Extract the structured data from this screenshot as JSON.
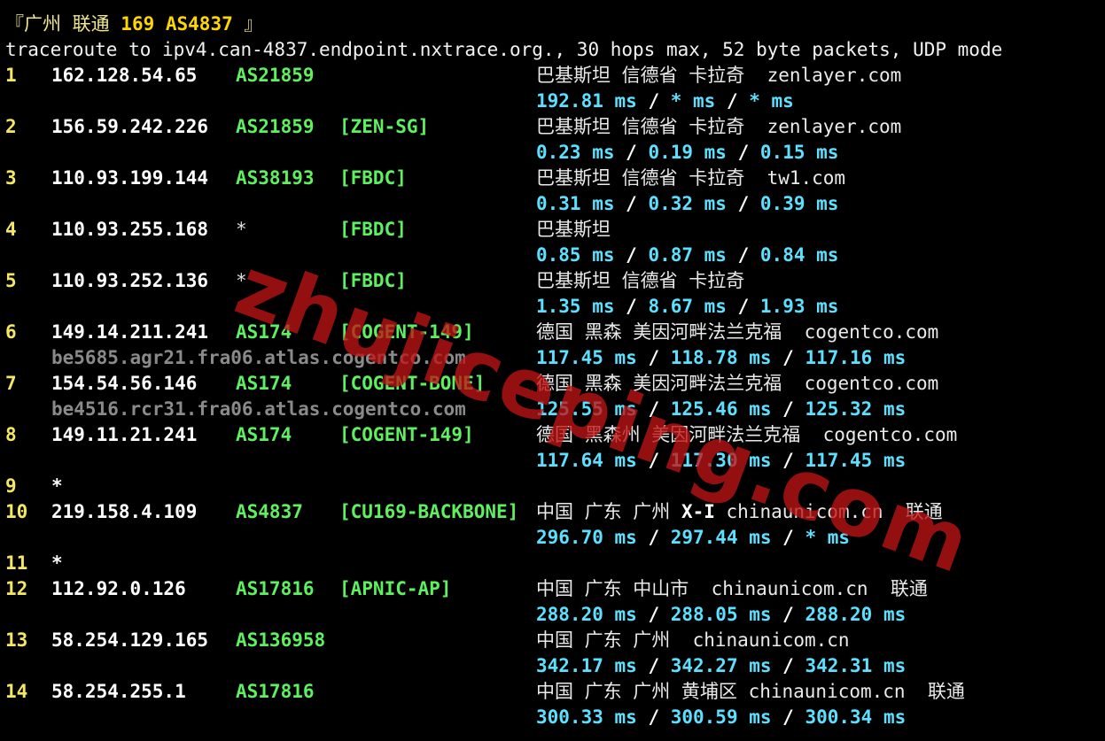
{
  "header": {
    "title_open": "『广州 联通 ",
    "title_bold": "169 AS4837",
    "title_close": " 』",
    "command": "traceroute to ipv4.can-4837.endpoint.nxtrace.org., 30 hops max, 52 byte packets, UDP mode"
  },
  "hops": [
    {
      "num": "1",
      "ip": "162.128.54.65",
      "as": "AS21859",
      "tag": "",
      "geo": "巴基斯坦 信德省 卡拉奇  zenlayer.com",
      "geo_hl": "",
      "rtt": [
        "192.81 ms",
        "* ms",
        "* ms"
      ],
      "rdns": ""
    },
    {
      "num": "2",
      "ip": "156.59.242.226",
      "as": "AS21859",
      "tag": "[ZEN-SG]",
      "geo": "巴基斯坦 信德省 卡拉奇  zenlayer.com",
      "geo_hl": "",
      "rtt": [
        "0.23 ms",
        "0.19 ms",
        "0.15 ms"
      ],
      "rdns": ""
    },
    {
      "num": "3",
      "ip": "110.93.199.144",
      "as": "AS38193",
      "tag": "[FBDC]",
      "geo": "巴基斯坦 信德省 卡拉奇  tw1.com",
      "geo_hl": "",
      "rtt": [
        "0.31 ms",
        "0.32 ms",
        "0.39 ms"
      ],
      "rdns": ""
    },
    {
      "num": "4",
      "ip": "110.93.255.168",
      "as": "*",
      "tag": "[FBDC]",
      "geo": "巴基斯坦",
      "geo_hl": "",
      "rtt": [
        "0.85 ms",
        "0.87 ms",
        "0.84 ms"
      ],
      "rdns": ""
    },
    {
      "num": "5",
      "ip": "110.93.252.136",
      "as": "*",
      "tag": "[FBDC]",
      "geo": "巴基斯坦 信德省 卡拉奇",
      "geo_hl": "",
      "rtt": [
        "1.35 ms",
        "8.67 ms",
        "1.93 ms"
      ],
      "rdns": ""
    },
    {
      "num": "6",
      "ip": "149.14.211.241",
      "as": "AS174",
      "tag": "[COGENT-149]",
      "geo": "德国 黑森 美因河畔法兰克福  cogentco.com",
      "geo_hl": "",
      "rtt": [
        "117.45 ms",
        "118.78 ms",
        "117.16 ms"
      ],
      "rdns": "be5685.agr21.fra06.atlas.cogentco.com"
    },
    {
      "num": "7",
      "ip": "154.54.56.146",
      "as": "AS174",
      "tag": "[COGENT-BONE]",
      "geo": "德国 黑森 美因河畔法兰克福  cogentco.com",
      "geo_hl": "",
      "rtt": [
        "125.55 ms",
        "125.46 ms",
        "125.32 ms"
      ],
      "rdns": "be4516.rcr31.fra06.atlas.cogentco.com"
    },
    {
      "num": "8",
      "ip": "149.11.21.241",
      "as": "AS174",
      "tag": "[COGENT-149]",
      "geo": "德国 黑森州 美因河畔法兰克福  cogentco.com",
      "geo_hl": "",
      "rtt": [
        "117.64 ms",
        "117.30 ms",
        "117.45 ms"
      ],
      "rdns": ""
    },
    {
      "num": "9",
      "ip": "*",
      "as": "",
      "tag": "",
      "geo": "",
      "geo_hl": "",
      "rtt": [],
      "rdns": ""
    },
    {
      "num": "10",
      "ip": "219.158.4.109",
      "as": "AS4837",
      "tag": "[CU169-BACKBONE]",
      "geo": "中国 广东 广州 ",
      "geo_hl": "X-I",
      "geo_tail": " chinaunicom.cn  联通",
      "rtt": [
        "296.70 ms",
        "297.44 ms",
        "* ms"
      ],
      "rdns": ""
    },
    {
      "num": "11",
      "ip": "*",
      "as": "",
      "tag": "",
      "geo": "",
      "geo_hl": "",
      "rtt": [],
      "rdns": ""
    },
    {
      "num": "12",
      "ip": "112.92.0.126",
      "as": "AS17816",
      "tag": "[APNIC-AP]",
      "geo": "中国 广东 中山市  chinaunicom.cn  联通",
      "geo_hl": "",
      "rtt": [
        "288.20 ms",
        "288.05 ms",
        "288.20 ms"
      ],
      "rdns": ""
    },
    {
      "num": "13",
      "ip": "58.254.129.165",
      "as": "AS136958",
      "tag": "",
      "geo": "中国 广东 广州  chinaunicom.cn",
      "geo_hl": "",
      "rtt": [
        "342.17 ms",
        "342.27 ms",
        "342.31 ms"
      ],
      "rdns": ""
    },
    {
      "num": "14",
      "ip": "58.254.255.1",
      "as": "AS17816",
      "tag": "",
      "geo": "中国 广东 广州 黄埔区 chinaunicom.cn  联通",
      "geo_hl": "",
      "rtt": [
        "300.33 ms",
        "300.59 ms",
        "300.34 ms"
      ],
      "rdns": ""
    }
  ],
  "watermark": "zhujiceping.com"
}
